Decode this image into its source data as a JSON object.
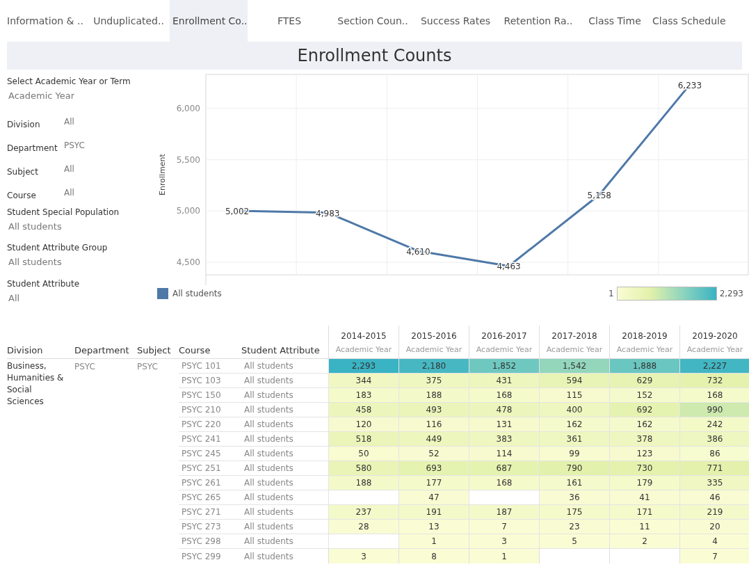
{
  "tabs": [
    {
      "label": "Information & ..",
      "selected": false
    },
    {
      "label": "Unduplicated..",
      "selected": false
    },
    {
      "label": "Enrollment Co..",
      "selected": true
    },
    {
      "label": "FTES",
      "selected": false
    },
    {
      "label": "Section Coun..",
      "selected": false
    },
    {
      "label": "Success Rates",
      "selected": false
    },
    {
      "label": "Retention Ra..",
      "selected": false
    },
    {
      "label": "Class Time",
      "selected": false
    },
    {
      "label": "Class Schedule",
      "selected": false
    }
  ],
  "title": "Enrollment Counts",
  "filters": [
    {
      "kind": "stacked",
      "label": "Select Academic Year or Term",
      "value": "Academic Year"
    },
    {
      "kind": "inline",
      "label": "Division",
      "value": "All"
    },
    {
      "kind": "inline",
      "label": "Department",
      "value": "PSYC"
    },
    {
      "kind": "inline",
      "label": "Subject",
      "value": "All"
    },
    {
      "kind": "inline",
      "label": "Course",
      "value": "All"
    },
    {
      "kind": "stacked",
      "label": "Student Special Population",
      "value": "All students"
    },
    {
      "kind": "stacked",
      "label": "Student Attribute Group",
      "value": "All students"
    },
    {
      "kind": "stacked",
      "label": "Student Attribute",
      "value": "All"
    }
  ],
  "chart": {
    "chart_data": {
      "type": "line",
      "ylabel": "Enrollment",
      "ylim": [
        4378,
        6332
      ],
      "yticks": [
        {
          "value": 4500,
          "label": "4,500"
        },
        {
          "value": 5000,
          "label": "5,000"
        },
        {
          "value": 5500,
          "label": "5,500"
        },
        {
          "value": 6000,
          "label": "6,000"
        }
      ],
      "grid": true,
      "series": [
        {
          "name": "All students",
          "color": "#4e79a7",
          "values": [
            5002,
            4983,
            4610,
            4463,
            5158,
            6233
          ]
        }
      ],
      "value_labels": [
        "5,002",
        "4,983",
        "4,610",
        "4,463",
        "5,158",
        "6,233"
      ]
    }
  },
  "color_legend": {
    "min": "1",
    "max": "2,293"
  },
  "table": {
    "columns": [
      "Division",
      "Department",
      "Subject",
      "Course",
      "Student Attribute"
    ],
    "years": [
      {
        "year": "2014-2015",
        "term": "Academic Year"
      },
      {
        "year": "2015-2016",
        "term": "Academic Year"
      },
      {
        "year": "2016-2017",
        "term": "Academic Year"
      },
      {
        "year": "2017-2018",
        "term": "Academic Year"
      },
      {
        "year": "2018-2019",
        "term": "Academic Year"
      },
      {
        "year": "2019-2020",
        "term": "Academic Year"
      }
    ],
    "group": {
      "division": "Business, Humanities & Social Sciences",
      "department": "PSYC",
      "subject": "PSYC"
    },
    "rows": [
      {
        "course": "PSYC 101",
        "attribute": "All students",
        "cells": [
          {
            "kind": "value",
            "text": "2,293"
          },
          {
            "kind": "value",
            "text": "2,180"
          },
          {
            "kind": "value",
            "text": "1,852"
          },
          {
            "kind": "value",
            "text": "1,542"
          },
          {
            "kind": "value",
            "text": "1,888"
          },
          {
            "kind": "value",
            "text": "2,227"
          }
        ]
      },
      {
        "course": "PSYC 103",
        "attribute": "All students",
        "cells": [
          {
            "kind": "value",
            "text": "344"
          },
          {
            "kind": "value",
            "text": "375"
          },
          {
            "kind": "value",
            "text": "431"
          },
          {
            "kind": "value",
            "text": "594"
          },
          {
            "kind": "value",
            "text": "629"
          },
          {
            "kind": "value",
            "text": "732"
          }
        ]
      },
      {
        "course": "PSYC 150",
        "attribute": "All students",
        "cells": [
          {
            "kind": "value",
            "text": "183"
          },
          {
            "kind": "value",
            "text": "188"
          },
          {
            "kind": "value",
            "text": "168"
          },
          {
            "kind": "value",
            "text": "115"
          },
          {
            "kind": "value",
            "text": "152"
          },
          {
            "kind": "value",
            "text": "168"
          }
        ]
      },
      {
        "course": "PSYC 210",
        "attribute": "All students",
        "cells": [
          {
            "kind": "value",
            "text": "458"
          },
          {
            "kind": "value",
            "text": "493"
          },
          {
            "kind": "value",
            "text": "478"
          },
          {
            "kind": "value",
            "text": "400"
          },
          {
            "kind": "value",
            "text": "692"
          },
          {
            "kind": "value",
            "text": "990"
          }
        ]
      },
      {
        "course": "PSYC 220",
        "attribute": "All students",
        "cells": [
          {
            "kind": "value",
            "text": "120"
          },
          {
            "kind": "value",
            "text": "116"
          },
          {
            "kind": "value",
            "text": "131"
          },
          {
            "kind": "value",
            "text": "162"
          },
          {
            "kind": "value",
            "text": "162"
          },
          {
            "kind": "value",
            "text": "242"
          }
        ]
      },
      {
        "course": "PSYC 241",
        "attribute": "All students",
        "cells": [
          {
            "kind": "value",
            "text": "518"
          },
          {
            "kind": "value",
            "text": "449"
          },
          {
            "kind": "value",
            "text": "383"
          },
          {
            "kind": "value",
            "text": "361"
          },
          {
            "kind": "value",
            "text": "378"
          },
          {
            "kind": "value",
            "text": "386"
          }
        ]
      },
      {
        "course": "PSYC 245",
        "attribute": "All students",
        "cells": [
          {
            "kind": "value",
            "text": "50"
          },
          {
            "kind": "value",
            "text": "52"
          },
          {
            "kind": "value",
            "text": "114"
          },
          {
            "kind": "value",
            "text": "99"
          },
          {
            "kind": "value",
            "text": "123"
          },
          {
            "kind": "value",
            "text": "86"
          }
        ]
      },
      {
        "course": "PSYC 251",
        "attribute": "All students",
        "cells": [
          {
            "kind": "value",
            "text": "580"
          },
          {
            "kind": "value",
            "text": "693"
          },
          {
            "kind": "value",
            "text": "687"
          },
          {
            "kind": "value",
            "text": "790"
          },
          {
            "kind": "value",
            "text": "730"
          },
          {
            "kind": "value",
            "text": "771"
          }
        ]
      },
      {
        "course": "PSYC 261",
        "attribute": "All students",
        "cells": [
          {
            "kind": "value",
            "text": "188"
          },
          {
            "kind": "value",
            "text": "177"
          },
          {
            "kind": "value",
            "text": "168"
          },
          {
            "kind": "value",
            "text": "161"
          },
          {
            "kind": "value",
            "text": "179"
          },
          {
            "kind": "value",
            "text": "335"
          }
        ]
      },
      {
        "course": "PSYC 265",
        "attribute": "All students",
        "cells": [
          {
            "kind": "blank"
          },
          {
            "kind": "value",
            "text": "47"
          },
          {
            "kind": "blank"
          },
          {
            "kind": "value",
            "text": "36"
          },
          {
            "kind": "value",
            "text": "41"
          },
          {
            "kind": "value",
            "text": "46"
          }
        ]
      },
      {
        "course": "PSYC 271",
        "attribute": "All students",
        "cells": [
          {
            "kind": "value",
            "text": "237"
          },
          {
            "kind": "value",
            "text": "191"
          },
          {
            "kind": "value",
            "text": "187"
          },
          {
            "kind": "value",
            "text": "175"
          },
          {
            "kind": "value",
            "text": "171"
          },
          {
            "kind": "value",
            "text": "219"
          }
        ]
      },
      {
        "course": "PSYC 273",
        "attribute": "All students",
        "cells": [
          {
            "kind": "value",
            "text": "28"
          },
          {
            "kind": "value",
            "text": "13"
          },
          {
            "kind": "value",
            "text": "7"
          },
          {
            "kind": "value",
            "text": "23"
          },
          {
            "kind": "value",
            "text": "11"
          },
          {
            "kind": "value",
            "text": "20"
          }
        ]
      },
      {
        "course": "PSYC 298",
        "attribute": "All students",
        "cells": [
          {
            "kind": "blank"
          },
          {
            "kind": "value",
            "text": "1"
          },
          {
            "kind": "value",
            "text": "3"
          },
          {
            "kind": "value",
            "text": "5"
          },
          {
            "kind": "value",
            "text": "2"
          },
          {
            "kind": "value",
            "text": "4"
          }
        ]
      },
      {
        "course": "PSYC 299",
        "attribute": "All students",
        "cells": [
          {
            "kind": "value",
            "text": "3"
          },
          {
            "kind": "value",
            "text": "8"
          },
          {
            "kind": "value",
            "text": "1"
          },
          {
            "kind": "blank"
          },
          {
            "kind": "blank"
          },
          {
            "kind": "value",
            "text": "7"
          }
        ]
      }
    ]
  }
}
